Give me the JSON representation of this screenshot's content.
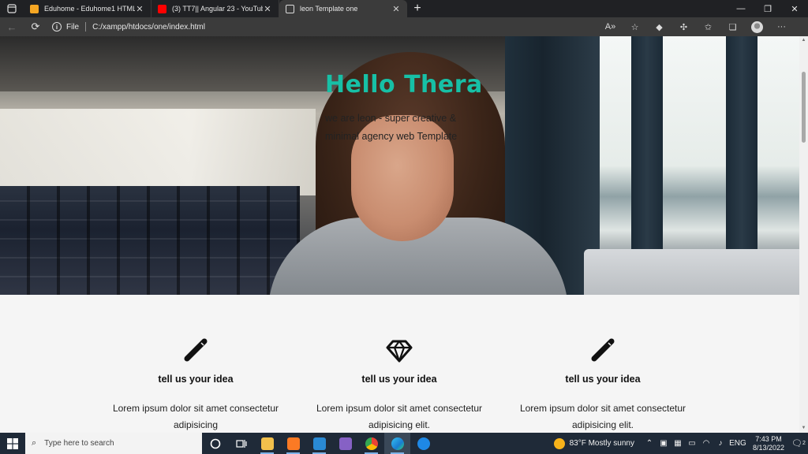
{
  "browser": {
    "tabs": [
      {
        "title": "Eduhome - Eduhome1 HTML Ter",
        "favicon": "eduhome-favicon",
        "color": "#f5a623"
      },
      {
        "title": "(3) TT7|| Angular 23 - YouTube",
        "favicon": "youtube-favicon",
        "color": "#ff0000"
      },
      {
        "title": "leon Template one",
        "favicon": "file-favicon",
        "color": "#dcdcdc",
        "active": true
      }
    ],
    "address": {
      "scheme_label": "File",
      "url": "C:/xampp/htdocs/one/index.html"
    }
  },
  "page": {
    "hero": {
      "title": "Hello Thera",
      "subtitle": "we are leon - super creative & minimal agency web Template"
    },
    "features": [
      {
        "icon": "pencil-icon",
        "title": "tell us your idea",
        "text": "Lorem ipsum dolor sit amet consectetur adipisicing"
      },
      {
        "icon": "diamond-icon",
        "title": "tell us your idea",
        "text": "Lorem ipsum dolor sit amet consectetur adipisicing elit."
      },
      {
        "icon": "pencil-icon",
        "title": "tell us your idea",
        "text": "Lorem ipsum dolor sit amet consectetur adipisicing elit."
      }
    ],
    "accent_color": "#17c0a6"
  },
  "taskbar": {
    "search_placeholder": "Type here to search",
    "weather": "83°F  Mostly sunny",
    "language": "ENG",
    "time": "7:43 PM",
    "date": "8/13/2022",
    "notification_count": "2"
  }
}
